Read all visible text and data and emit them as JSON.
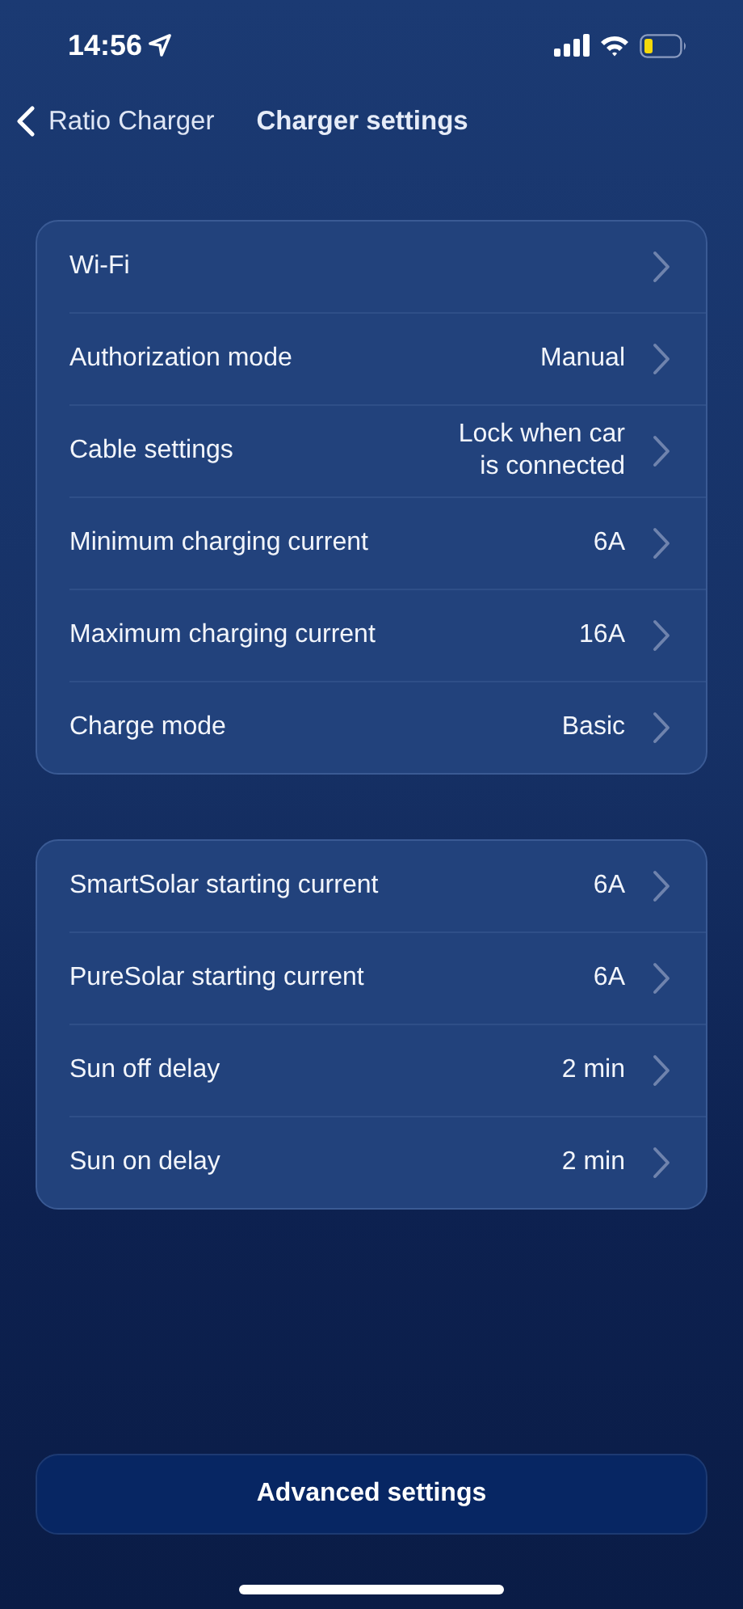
{
  "status_bar": {
    "time": "14:56"
  },
  "nav": {
    "back_label": "Ratio Charger",
    "title": "Charger settings"
  },
  "groups": [
    {
      "rows": [
        {
          "label": "Wi-Fi"
        },
        {
          "label": "Authorization mode",
          "value": "Manual"
        },
        {
          "label": "Cable settings",
          "value": "Lock when car\nis connected"
        },
        {
          "label": "Minimum charging current",
          "value": "6A"
        },
        {
          "label": "Maximum charging current",
          "value": "16A"
        },
        {
          "label": "Charge mode",
          "value": "Basic"
        }
      ]
    },
    {
      "rows": [
        {
          "label": "SmartSolar starting current",
          "value": "6A"
        },
        {
          "label": "PureSolar starting current",
          "value": "6A"
        },
        {
          "label": "Sun off delay",
          "value": "2 min"
        },
        {
          "label": "Sun on delay",
          "value": "2 min"
        }
      ]
    }
  ],
  "footer_button": "Advanced settings"
}
